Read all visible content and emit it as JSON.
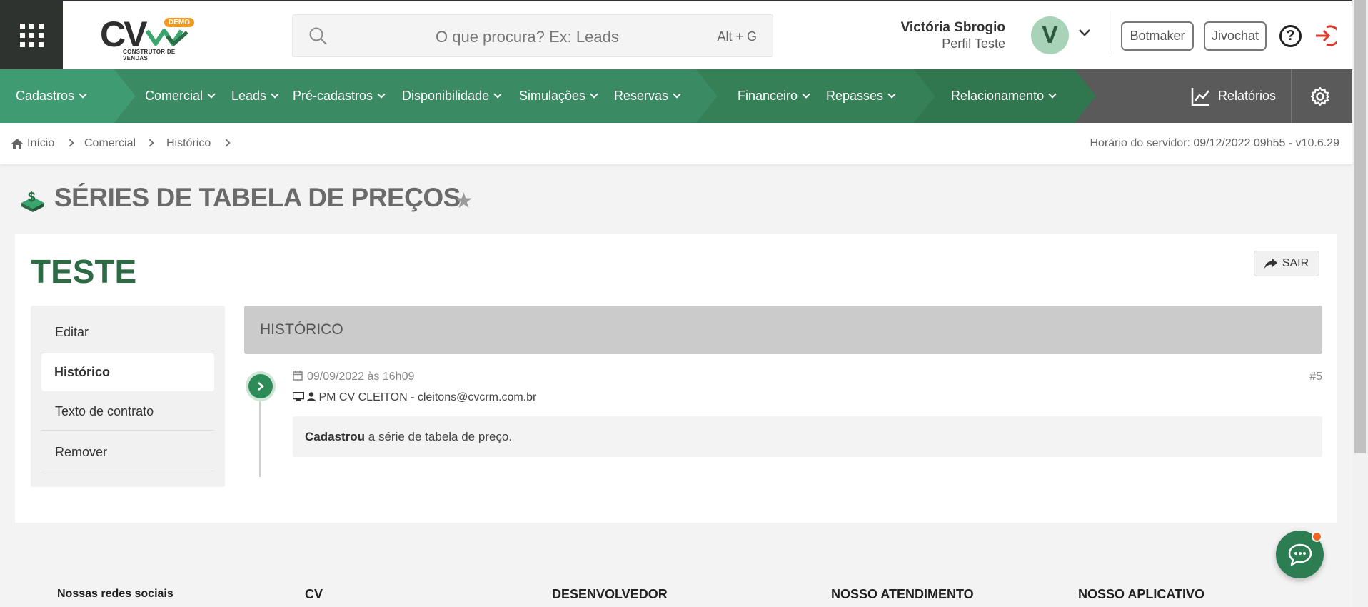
{
  "header": {
    "logo_text": "CV",
    "logo_badge": "DEMO",
    "logo_subtitle": "CONSTRUTOR DE VENDAS",
    "search_placeholder": "O que procura? Ex: Leads",
    "search_shortcut": "Alt + G",
    "user_name": "Victória Sbrogio",
    "user_role": "Perfil Teste",
    "avatar_letter": "V",
    "botmaker_label": "Botmaker",
    "jivochat_label": "Jivochat",
    "help_label": "?"
  },
  "nav": {
    "items": [
      {
        "label": "Cadastros"
      },
      {
        "label": "Comercial"
      },
      {
        "label": "Leads"
      },
      {
        "label": "Pré-cadastros"
      },
      {
        "label": "Disponibilidade"
      },
      {
        "label": "Simulações"
      },
      {
        "label": "Reservas"
      },
      {
        "label": "Financeiro"
      },
      {
        "label": "Repasses"
      },
      {
        "label": "Relacionamento"
      }
    ],
    "reports_label": "Relatórios"
  },
  "breadcrumb": {
    "items": [
      "Início",
      "Comercial",
      "Histórico"
    ],
    "server_time": "Horário do servidor: 09/12/2022 09h55 - v10.6.29"
  },
  "page": {
    "title": "SÉRIES DE TABELA DE PREÇOS",
    "record_title": "TESTE",
    "exit_label": "SAIR"
  },
  "sidebar": {
    "items": [
      {
        "label": "Editar"
      },
      {
        "label": "Histórico"
      },
      {
        "label": "Texto de contrato"
      },
      {
        "label": "Remover"
      }
    ]
  },
  "history": {
    "header": "HISTÓRICO",
    "entries": [
      {
        "date": "09/09/2022 às 16h09",
        "number": "#5",
        "user": "PM CV CLEITON - cleitons@cvcrm.com.br",
        "action": "Cadastrou",
        "text": " a série de tabela de preço."
      }
    ]
  },
  "footer": {
    "social": "Nossas redes sociais",
    "col_cv": "CV",
    "col_dev": "DESENVOLVEDOR",
    "col_support": "NOSSO ATENDIMENTO",
    "col_app": "NOSSO APLICATIVO"
  },
  "colors": {
    "brand_green": "#2d6b45",
    "nav_green_light": "#3f9b72",
    "nav_gray": "#5a5a5a",
    "logout_red": "#e03a2e",
    "notification_orange": "#f26522"
  }
}
